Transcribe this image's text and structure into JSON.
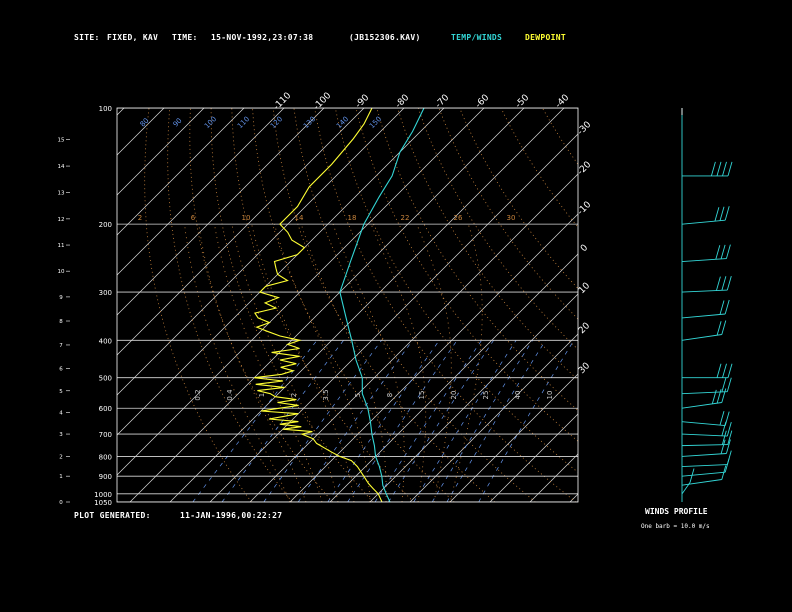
{
  "header": {
    "site_label": "SITE:",
    "site_value": "FIXED, KAV",
    "time_label": "TIME:",
    "time_value": "15-NOV-1992,23:07:38",
    "file_value": "(JB152306.KAV)",
    "temp_winds_label": "TEMP/WINDS",
    "dewpoint_label": "DEWPOINT"
  },
  "footer": {
    "plot_generated_label": "PLOT GENERATED:",
    "plot_generated_value": "11-JAN-1996,00:22:27"
  },
  "colors": {
    "temperature": "#33d6d6",
    "dewpoint": "#ffff33",
    "isobars": "#d9d9d9",
    "isotherms": "#d9d9d9",
    "dry_adiabats": "#c8843c",
    "moist_adiabats": "#c8843c",
    "mixing_ratio": "#6495ed",
    "wind": "#33d6d6",
    "text": "#ffffff"
  },
  "chart_data": {
    "type": "line",
    "subtype": "skew-T log-P diagram",
    "x_temperature_ticks": [
      -110,
      -100,
      -90,
      -80,
      -70,
      -60,
      -50,
      -40,
      -30,
      -20,
      -10,
      0,
      10,
      20,
      30
    ],
    "pressure_ticks": [
      100,
      200,
      300,
      400,
      500,
      600,
      700,
      800,
      900,
      1000,
      1050
    ],
    "height_km_ticks": [
      0,
      1,
      2,
      3,
      4,
      5,
      6,
      7,
      8,
      9,
      10,
      11,
      12,
      13,
      14,
      15
    ],
    "dry_adiabat_labels": [
      80,
      90,
      100,
      110,
      120,
      130,
      140,
      150
    ],
    "moist_adiabat_labels": [
      2,
      6,
      10,
      14,
      18,
      22,
      26,
      30
    ],
    "mixing_ratio_labels": [
      0.2,
      0.4,
      1.0,
      2.0,
      3.5,
      5.0,
      8.0,
      15,
      20,
      25,
      40,
      10
    ],
    "temperature_profile": {
      "name": "TEMP/WINDS",
      "pressure": [
        1050,
        1000,
        950,
        900,
        850,
        800,
        750,
        700,
        650,
        600,
        550,
        500,
        450,
        400,
        350,
        300,
        250,
        200,
        170,
        150,
        130,
        115,
        100
      ],
      "temp_c": [
        15,
        12,
        9,
        6.5,
        3.5,
        0,
        -3,
        -6.5,
        -10,
        -14,
        -19,
        -23,
        -29,
        -35,
        -42,
        -50,
        -55,
        -61,
        -64,
        -66,
        -70,
        -72,
        -75
      ]
    },
    "dewpoint_profile": {
      "name": "DEWPOINT",
      "pressure": [
        1050,
        1000,
        970,
        940,
        900,
        850,
        820,
        800,
        780,
        760,
        740,
        720,
        700,
        690,
        680,
        670,
        660,
        650,
        640,
        630,
        620,
        610,
        600,
        590,
        580,
        570,
        560,
        550,
        540,
        530,
        520,
        510,
        500,
        490,
        480,
        470,
        460,
        450,
        440,
        430,
        420,
        410,
        400,
        390,
        380,
        370,
        360,
        350,
        340,
        330,
        320,
        310,
        300,
        290,
        280,
        270,
        260,
        250,
        240,
        230,
        220,
        210,
        200,
        180,
        160,
        140,
        120,
        110,
        100
      ],
      "dewpt_c": [
        13,
        10,
        7.5,
        5,
        2,
        -2,
        -5,
        -9,
        -12,
        -15,
        -18,
        -20,
        -24,
        -22,
        -30,
        -26,
        -32,
        -28,
        -36,
        -33,
        -30,
        -40,
        -36,
        -32,
        -38,
        -34,
        -40,
        -42,
        -46,
        -40,
        -48,
        -42,
        -50,
        -44,
        -42,
        -46,
        -43,
        -48,
        -44,
        -52,
        -46,
        -50,
        -48,
        -54,
        -58,
        -62,
        -60,
        -64,
        -66,
        -62,
        -66,
        -64,
        -70,
        -70,
        -66,
        -70,
        -72,
        -74,
        -70,
        -70,
        -75,
        -78,
        -82,
        -82,
        -84,
        -84,
        -85,
        -86,
        -88
      ]
    },
    "height_km_per_pressure": {
      "pressure": [
        1050,
        1000,
        900,
        800,
        700,
        600,
        500,
        400,
        300,
        200,
        100
      ],
      "height_km": [
        0,
        0.1,
        1,
        2,
        3,
        4.2,
        5.6,
        7.2,
        9.2,
        11.8,
        16.2
      ]
    },
    "wind_profile": {
      "title": "WINDS PROFILE",
      "subtitle": "One barb = 10.0 m/s",
      "barbs": [
        {
          "pressure": 1000,
          "speed_ms": 5,
          "dir_deg": 350
        },
        {
          "pressure": 950,
          "speed_ms": 8,
          "dir_deg": 300
        },
        {
          "pressure": 900,
          "speed_ms": 10,
          "dir_deg": 290
        },
        {
          "pressure": 850,
          "speed_ms": 14,
          "dir_deg": 280
        },
        {
          "pressure": 800,
          "speed_ms": 18,
          "dir_deg": 285
        },
        {
          "pressure": 750,
          "speed_ms": 22,
          "dir_deg": 275
        },
        {
          "pressure": 700,
          "speed_ms": 20,
          "dir_deg": 260
        },
        {
          "pressure": 650,
          "speed_ms": 24,
          "dir_deg": 250
        },
        {
          "pressure": 600,
          "speed_ms": 26,
          "dir_deg": 300
        },
        {
          "pressure": 550,
          "speed_ms": 22,
          "dir_deg": 280
        },
        {
          "pressure": 500,
          "speed_ms": 25,
          "dir_deg": 270
        },
        {
          "pressure": 400,
          "speed_ms": 20,
          "dir_deg": 300
        },
        {
          "pressure": 350,
          "speed_ms": 24,
          "dir_deg": 290
        },
        {
          "pressure": 300,
          "speed_ms": 30,
          "dir_deg": 280
        },
        {
          "pressure": 250,
          "speed_ms": 32,
          "dir_deg": 285
        },
        {
          "pressure": 200,
          "speed_ms": 30,
          "dir_deg": 290
        },
        {
          "pressure": 150,
          "speed_ms": 38,
          "dir_deg": 270
        }
      ]
    }
  }
}
